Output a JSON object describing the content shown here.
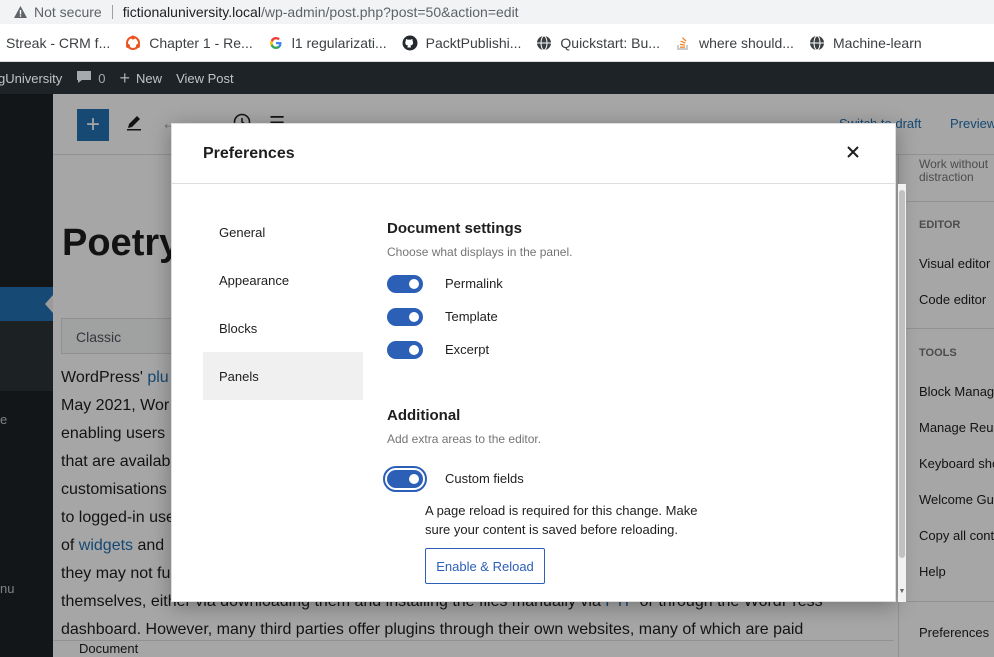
{
  "browser": {
    "not_secure": "Not secure",
    "url_host": "fictionaluniversity.local",
    "url_path": "/wp-admin/post.php?post=50&action=edit",
    "bookmarks": [
      {
        "label": "Streak - CRM f...",
        "icon": "none"
      },
      {
        "label": "Chapter 1 - Re...",
        "icon": "ubuntu-icon"
      },
      {
        "label": "l1 regularizati...",
        "icon": "google-icon"
      },
      {
        "label": "PacktPublishi...",
        "icon": "github-icon"
      },
      {
        "label": "Quickstart: Bu...",
        "icon": "globe-icon"
      },
      {
        "label": "where should...",
        "icon": "stackoverflow-icon"
      },
      {
        "label": "Machine-learn",
        "icon": "globe-icon"
      }
    ]
  },
  "adminbar": {
    "site": "gUniversity",
    "comments_count": "0",
    "new_label": "New",
    "view_post": "View Post"
  },
  "adminmenu": {
    "frag1": "e",
    "frag2": "nu"
  },
  "editor": {
    "switch_to_draft": "Switch to draft",
    "preview": "Preview",
    "post_title": "Poetry",
    "classic_label": "Classic",
    "body": {
      "line1_pre": "WordPress' ",
      "line1_link": "plu",
      "line2": "May 2021, Wor",
      "line3": "enabling users",
      "line4": "that are availab",
      "line5": "customisations",
      "line6": "to logged-in use",
      "line7_pre": "of ",
      "line7_link": "widgets",
      "line7_post": " and",
      "line8": "they may not fu",
      "line9_pre": "themselves, either via downloading them and installing the files manually via ",
      "line9_link": "FTP",
      "line9_post": " or through the WordPress",
      "line10": "dashboard. However, many third parties offer plugins through their own websites, many of which are paid"
    },
    "document_tab": "Document"
  },
  "sidebar": {
    "work_without": "Work without",
    "distraction": "distraction",
    "editor_head": "EDITOR",
    "visual_editor": "Visual editor",
    "code_editor": "Code editor",
    "tools_head": "TOOLS",
    "block_manager": "Block Manag",
    "manage_reusable": "Manage Reus",
    "keyboard_shortcuts": "Keyboard sho",
    "welcome_guide": "Welcome Gu",
    "copy_all": "Copy all cont",
    "help": "Help",
    "preferences": "Preferences"
  },
  "modal": {
    "title": "Preferences",
    "nav": [
      {
        "label": "General",
        "active": false
      },
      {
        "label": "Appearance",
        "active": false
      },
      {
        "label": "Blocks",
        "active": false
      },
      {
        "label": "Panels",
        "active": true
      }
    ],
    "document_settings": {
      "title": "Document settings",
      "desc": "Choose what displays in the panel.",
      "toggles": [
        {
          "label": "Permalink",
          "on": true
        },
        {
          "label": "Template",
          "on": true
        },
        {
          "label": "Excerpt",
          "on": true
        }
      ]
    },
    "additional": {
      "title": "Additional",
      "desc": "Add extra areas to the editor.",
      "custom_fields_label": "Custom fields",
      "custom_fields_on": true,
      "help_text": "A page reload is required for this change. Make sure your content is saved before reloading.",
      "reload_button": "Enable & Reload"
    }
  },
  "colors": {
    "accent": "#2c5fb6",
    "wp_dark": "#1d2327",
    "wp_blue": "#2271b1"
  }
}
